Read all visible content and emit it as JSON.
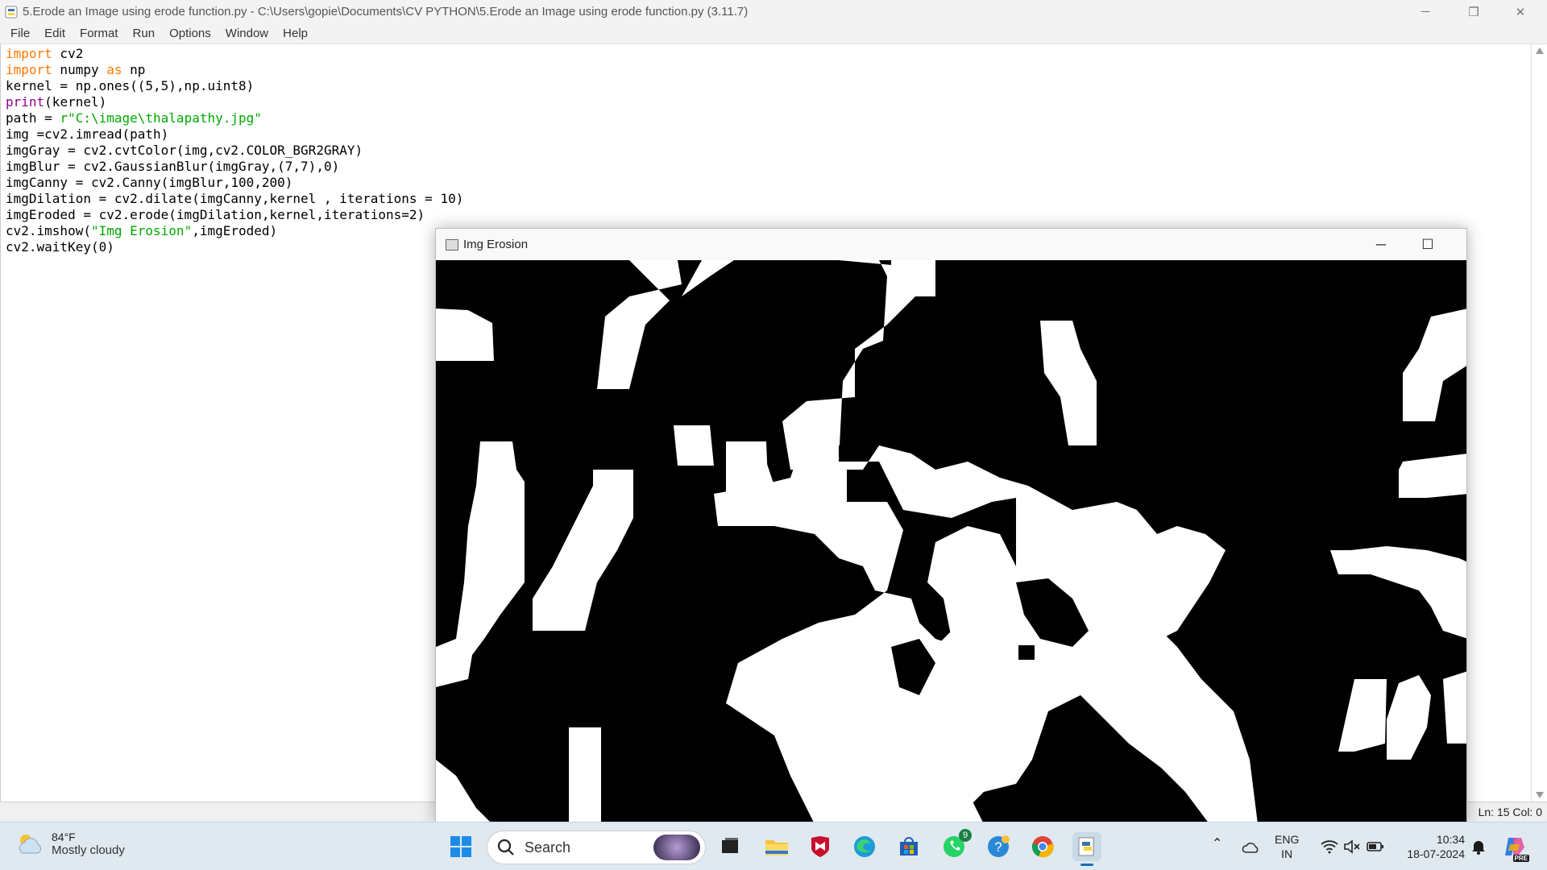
{
  "titlebar": {
    "title": "5.Erode an Image using erode function.py - C:\\Users\\gopie\\Documents\\CV PYTHON\\5.Erode an Image using erode function.py (3.11.7)",
    "minimize": "─",
    "restore": "❐",
    "close": "✕"
  },
  "menu": [
    "File",
    "Edit",
    "Format",
    "Run",
    "Options",
    "Window",
    "Help"
  ],
  "code": [
    [
      {
        "t": "import",
        "c": "kw"
      },
      {
        "t": " cv2",
        "c": ""
      }
    ],
    [
      {
        "t": "import",
        "c": "kw"
      },
      {
        "t": " numpy ",
        "c": ""
      },
      {
        "t": "as",
        "c": "kw"
      },
      {
        "t": " np",
        "c": ""
      }
    ],
    [
      {
        "t": "kernel = np.ones((5,5),np.uint8)",
        "c": ""
      }
    ],
    [
      {
        "t": "print",
        "c": "bi"
      },
      {
        "t": "(kernel)",
        "c": ""
      }
    ],
    [
      {
        "t": "path = ",
        "c": ""
      },
      {
        "t": "r\"C:\\image\\thalapathy.jpg\"",
        "c": "st"
      }
    ],
    [
      {
        "t": "img =cv2.imread(path)",
        "c": ""
      }
    ],
    [
      {
        "t": "imgGray = cv2.cvtColor(img,cv2.COLOR_BGR2GRAY)",
        "c": ""
      }
    ],
    [
      {
        "t": "imgBlur = cv2.GaussianBlur(imgGray,(7,7),0)",
        "c": ""
      }
    ],
    [
      {
        "t": "imgCanny = cv2.Canny(imgBlur,100,200)",
        "c": ""
      }
    ],
    [
      {
        "t": "imgDilation = cv2.dilate(imgCanny,kernel , iterations = 10)",
        "c": ""
      }
    ],
    [
      {
        "t": "imgEroded = cv2.erode(imgDilation,kernel,iterations=2)",
        "c": ""
      }
    ],
    [
      {
        "t": "cv2.imshow(",
        "c": ""
      },
      {
        "t": "\"Img Erosion\"",
        "c": "st"
      },
      {
        "t": ",imgEroded)",
        "c": ""
      }
    ],
    [
      {
        "t": "cv2.waitKey(0)",
        "c": ""
      }
    ]
  ],
  "statusbar": {
    "position": "Ln: 15   Col: 0"
  },
  "image_window": {
    "title": "Img Erosion",
    "minimize": "─",
    "maximize": "☐",
    "close": "✕"
  },
  "taskbar": {
    "weather_temp": "84°F",
    "weather_desc": "Mostly cloudy",
    "search_label": "Search",
    "whatsapp_badge": "9",
    "lang_line1": "ENG",
    "lang_line2": "IN",
    "time": "10:34",
    "date": "18-07-2024",
    "copilot_badge": "PRE"
  },
  "colors": {
    "keyword": "#ff7700",
    "builtin": "#900090",
    "string": "#00aa00",
    "taskbar": "#dfe9ef"
  }
}
